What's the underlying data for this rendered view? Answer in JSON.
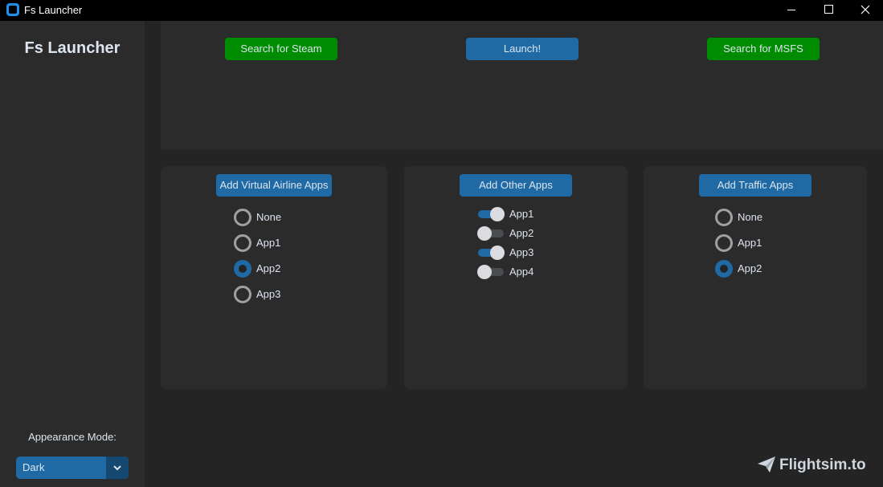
{
  "window": {
    "title": "Fs Launcher",
    "icon": "app-window-icon"
  },
  "sidebar": {
    "logo": "Fs Launcher",
    "appearance_label": "Appearance Mode:",
    "appearance_value": "Dark"
  },
  "top": {
    "search_steam": "Search for Steam",
    "launch": "Launch!",
    "search_msfs": "Search for MSFS"
  },
  "virtual_airline": {
    "button": "Add Virtual Airline Apps",
    "options": [
      "None",
      "App1",
      "App2",
      "App3"
    ],
    "selected": "App2"
  },
  "other_apps": {
    "button": "Add Other Apps",
    "switches": [
      {
        "label": "App1",
        "on": true
      },
      {
        "label": "App2",
        "on": false
      },
      {
        "label": "App3",
        "on": true
      },
      {
        "label": "App4",
        "on": false
      }
    ]
  },
  "traffic": {
    "button": "Add Traffic Apps",
    "options": [
      "None",
      "App1",
      "App2"
    ],
    "selected": "App2"
  },
  "watermark": {
    "text": "Flightsim.to",
    "icon": "paper-plane-icon"
  },
  "colors": {
    "accent_blue": "#1f6aa5",
    "accent_green": "#008c00",
    "background": "#242424",
    "frame": "#2b2b2b"
  }
}
